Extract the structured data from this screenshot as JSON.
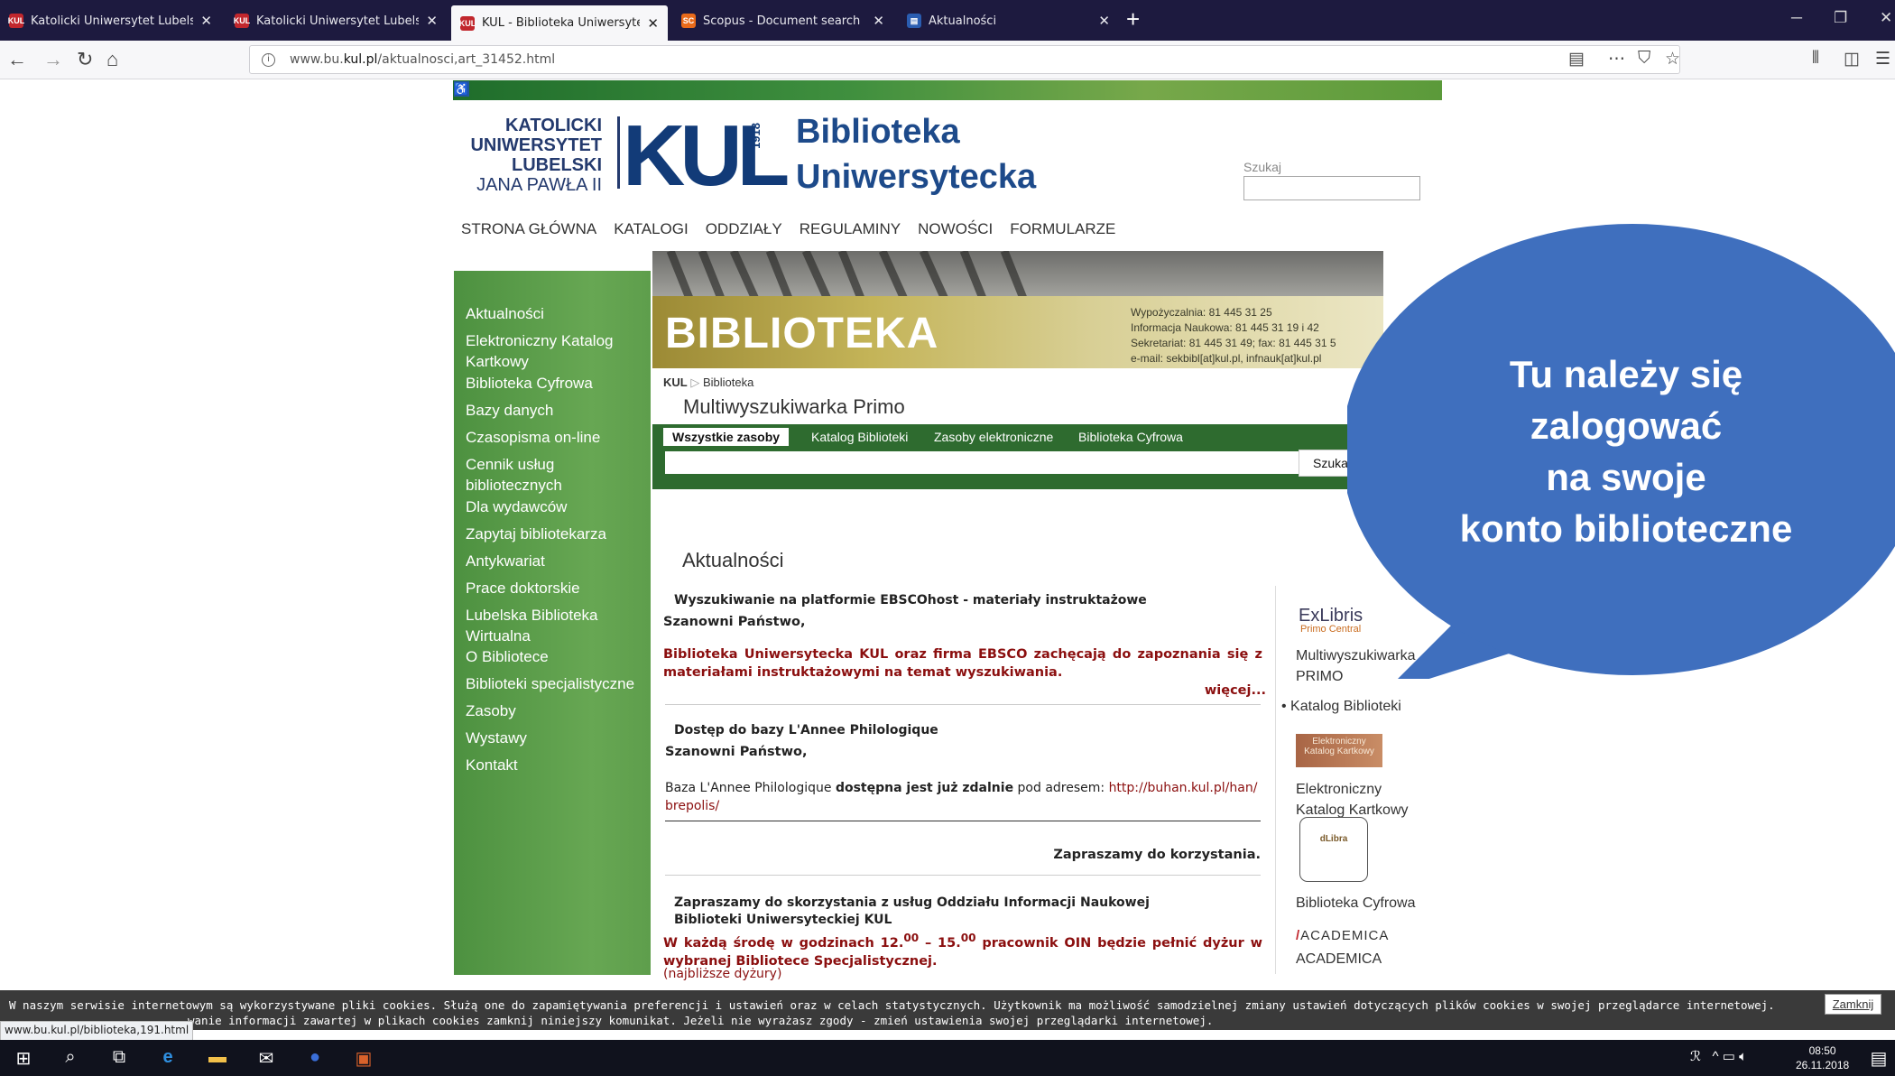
{
  "browser": {
    "tabs": [
      {
        "title": "Katolicki Uniwersytet Lubelski J",
        "favicon": "kul"
      },
      {
        "title": "Katolicki Uniwersytet Lubelski J",
        "favicon": "kul"
      },
      {
        "title": "KUL - Biblioteka Uniwersytecka",
        "favicon": "kul"
      },
      {
        "title": "Scopus - Document search",
        "favicon": "SC"
      },
      {
        "title": "Aktualności",
        "favicon": "bu"
      }
    ],
    "active_tab": 2,
    "url_prefix": "www.bu.",
    "url_domain": "kul.pl",
    "url_rest": "/aktualnosci,art_31452.html"
  },
  "site": {
    "logo_lines": [
      "KATOLICKI",
      "UNIWERSYTET",
      "LUBELSKI"
    ],
    "logo_jp": "JANA PAWŁA II",
    "logo_kul": "KUL",
    "logo_year": "1918",
    "title_line1": "Biblioteka",
    "title_line2": "Uniwersytecka",
    "search_label": "Szukaj",
    "menu": [
      "STRONA GŁÓWNA",
      "KATALOGI",
      "ODDZIAŁY",
      "REGULAMINY",
      "NOWOŚCI",
      "FORMULARZE"
    ]
  },
  "sidebar": [
    "Aktualności",
    "Elektroniczny Katalog Kartkowy",
    "Biblioteka Cyfrowa",
    "Bazy danych",
    "Czasopisma on-line",
    "Cennik usług bibliotecznych",
    "Dla wydawców",
    "Zapytaj bibliotekarza",
    "Antykwariat",
    "Prace doktorskie",
    "Lubelska Biblioteka Wirtualna",
    "O Bibliotece",
    "Biblioteki specjalistyczne",
    "Zasoby",
    "Wystawy",
    "Kontakt"
  ],
  "banner": {
    "word": "BIBLIOTEKA",
    "contact": [
      "Wypożyczalnia: 81 445 31 25",
      "Informacja Naukowa: 81 445 31 19 i 42",
      "Sekretariat: 81 445 31 49; fax: 81 445 31 5",
      "e-mail: sekbibl[at]kul.pl, infnauk[at]kul.pl"
    ]
  },
  "breadcrumb": {
    "root": "KUL",
    "current": "Biblioteka"
  },
  "primo": {
    "title": "Multiwyszukiwarka Primo",
    "tabs": [
      "Wszystkie zasoby",
      "Katalog Biblioteki",
      "Zasoby elektroniczne",
      "Biblioteka Cyfrowa"
    ],
    "active_tab": 0,
    "button": "Szukaj"
  },
  "news": {
    "heading": "Aktualności",
    "item1_title": "Wyszukiwanie na platformie EBSCOhost - materiały instruktażowe",
    "item1_greeting": "Szanowni Państwo,",
    "item1_body": "Biblioteka Uniwersytecka KUL oraz firma EBSCO zachęcają do zapoznania się z materiałami instruktażowymi na temat wyszukiwania.",
    "item1_more": "więcej...",
    "item2_title": "Dostęp do bazy L'Annee Philologique",
    "item2_greeting": "Szanowni Państwo,",
    "item2_pre": "Baza L'Annee Philologique ",
    "item2_bold": "dostępna jest już zdalnie",
    "item2_mid": " pod adresem: ",
    "item2_link": "http://buhan.kul.pl/han/brepolis/",
    "item2_invite": "Zapraszamy do korzystania.",
    "item3_title": "Zapraszamy do skorzystania z usług Oddziału Informacji Naukowej Biblioteki Uniwersyteckiej KUL",
    "item3_body_a": "W każdą środę w godzinach 12.",
    "item3_sup1": "00",
    "item3_body_b": " – 15.",
    "item3_sup2": "00",
    "item3_body_c": " pracownik OIN będzie pełnić dyżur w wybranej Bibliotece Specjalistycznej.",
    "item3_link": "(najbliższe dyżury)"
  },
  "rightcol": {
    "exlibris": "ExLibris",
    "exlibris_sub": "Primo Central",
    "primo_link": "Multiwyszukiwarka PRIMO",
    "katalog": "Katalog Biblioteki",
    "ekk_image_text": "Elektroniczny Katalog Kartkowy",
    "ekk_link": "Elektroniczny Katalog Kartkowy",
    "dlibra_image_text": "dLibra",
    "cyfrowa": "Biblioteka Cyfrowa",
    "academica_logo": "ACADEMICA",
    "academica": "ACADEMICA"
  },
  "callout": {
    "text_lines": [
      "Tu należy się",
      "zalogować",
      "na swoje",
      "konto biblioteczne"
    ],
    "color": "#3f6fbe"
  },
  "cookie": {
    "line1": "W naszym serwisie internetowym są wykorzystywane pliki cookies. Służą one do zapamiętywania preferencji i ustawień oraz w celach statystycznych. Użytkownik ma możliwość samodzielnej zmiany ustawień dotyczących plików cookies w swojej przeglądarce internetowej.",
    "line2": "wanie informacji zawartej w plikach cookies zamknij niniejszy komunikat. Jeżeli nie wyrażasz zgody - zmień ustawienia swojej przeglądarki internetowej.",
    "button": "Zamknij"
  },
  "status_url": "www.bu.kul.pl/biblioteka,191.html",
  "taskbar": {
    "time": "08:50",
    "date": "26.11.2018"
  }
}
